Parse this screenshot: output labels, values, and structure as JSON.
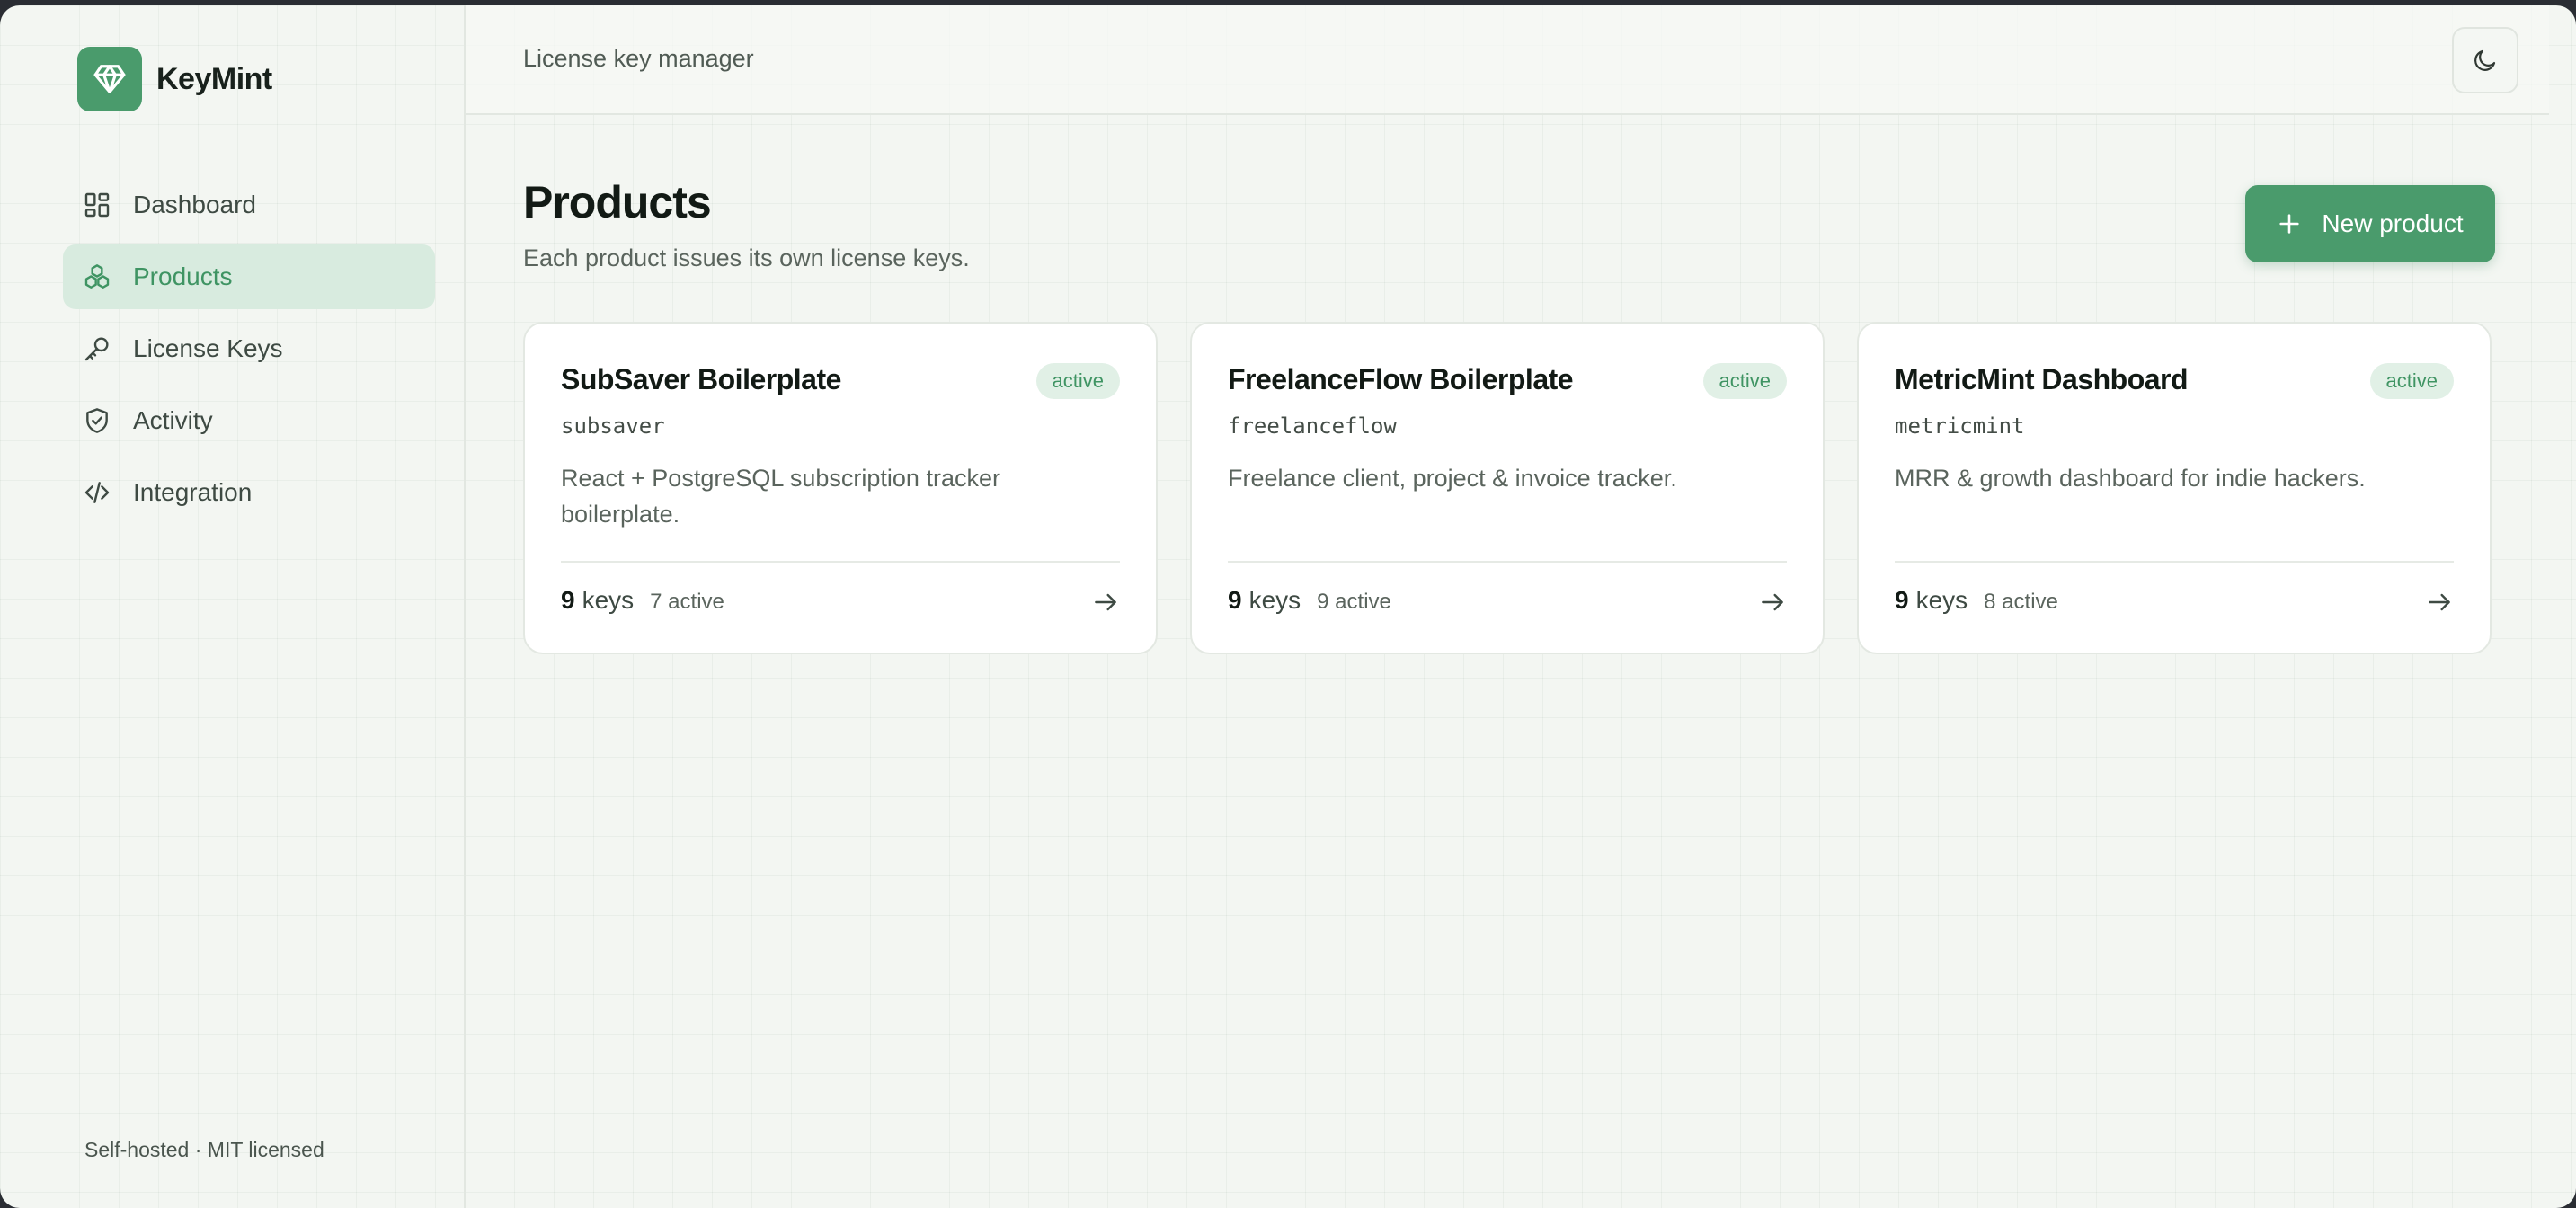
{
  "app": {
    "name": "KeyMint",
    "accent": "#4a9b6c"
  },
  "sidebar": {
    "items": [
      {
        "label": "Dashboard",
        "icon": "dashboard-icon"
      },
      {
        "label": "Products",
        "icon": "products-icon",
        "active": true
      },
      {
        "label": "License Keys",
        "icon": "key-icon"
      },
      {
        "label": "Activity",
        "icon": "shield-icon"
      },
      {
        "label": "Integration",
        "icon": "code-icon"
      }
    ],
    "footer": "Self-hosted · MIT licensed"
  },
  "topbar": {
    "title": "License key manager",
    "theme_toggle_icon": "moon-icon"
  },
  "main": {
    "title": "Products",
    "subtitle": "Each product issues its own license keys.",
    "new_button_label": "New product",
    "products": [
      {
        "name": "SubSaver Boilerplate",
        "status": "active",
        "slug": "subsaver",
        "description": "React + PostgreSQL subscription tracker boilerplate.",
        "keys": "9",
        "keys_label": "keys",
        "active_count": "7 active"
      },
      {
        "name": "FreelanceFlow Boilerplate",
        "status": "active",
        "slug": "freelanceflow",
        "description": "Freelance client, project & invoice tracker.",
        "keys": "9",
        "keys_label": "keys",
        "active_count": "9 active"
      },
      {
        "name": "MetricMint Dashboard",
        "status": "active",
        "slug": "metricmint",
        "description": "MRR & growth dashboard for indie hackers.",
        "keys": "9",
        "keys_label": "keys",
        "active_count": "8 active"
      }
    ]
  }
}
